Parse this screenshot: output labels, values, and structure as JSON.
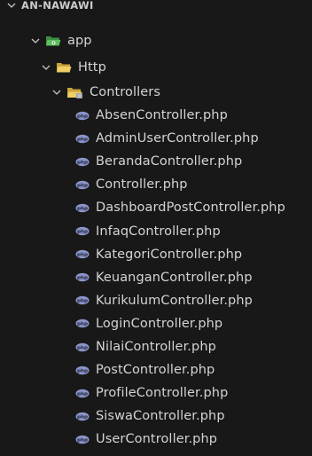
{
  "explorer": {
    "root_label": "AN-NAWAWI",
    "folders": {
      "app": "app",
      "http": "Http",
      "controllers": "Controllers"
    },
    "files": [
      "AbsenController.php",
      "AdminUserController.php",
      "BerandaController.php",
      "Controller.php",
      "DashboardPostController.php",
      "InfaqController.php",
      "KategoriController.php",
      "KeuanganController.php",
      "KurikulumController.php",
      "LoginController.php",
      "NilaiController.php",
      "PostController.php",
      "ProfileController.php",
      "SiswaController.php",
      "UserController.php"
    ],
    "icons": {
      "chevron": "chevron-down-icon",
      "app_folder": "folder-open-green-icon",
      "http_folder": "folder-open-icon",
      "controllers_folder": "folder-controller-icon",
      "php_file": "php-file-icon"
    },
    "colors": {
      "background": "#181818",
      "text": "#d4d4d4",
      "php_icon": "#8b95c9",
      "folder_yellow": "#e8c55a",
      "folder_green": "#4caf50"
    }
  }
}
